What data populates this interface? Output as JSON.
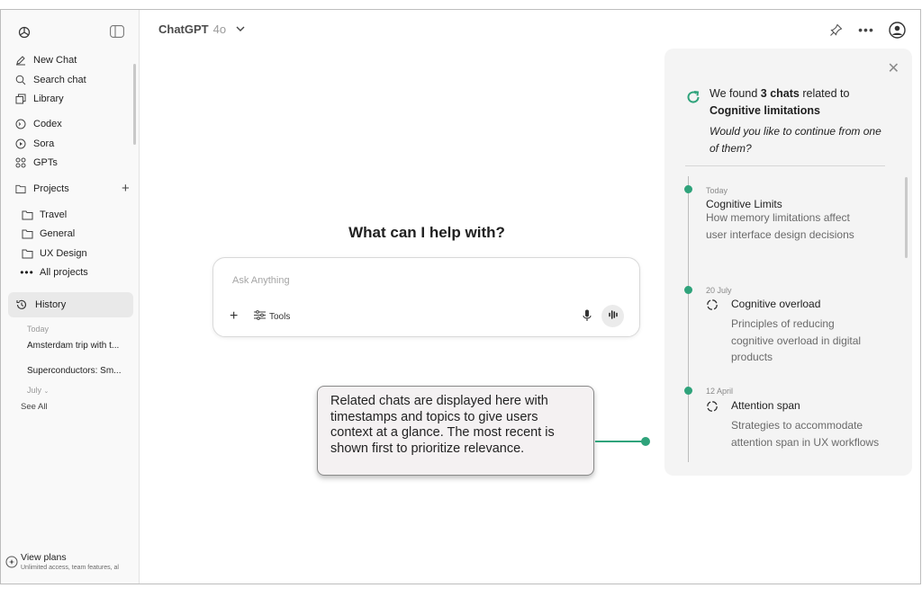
{
  "sidebar": {
    "new_chat": "New Chat",
    "search_chat": "Search chat",
    "library": "Library",
    "codex": "Codex",
    "sora": "Sora",
    "gpts": "GPTs",
    "projects_label": "Projects",
    "projects": [
      "Travel",
      "General",
      "UX Design",
      "All projects"
    ],
    "history_label": "History",
    "history_today": "Today",
    "history_items": [
      "Amsterdam trip with t...",
      "Superconductors: Sm..."
    ],
    "history_july": "July",
    "see_all": "See All",
    "view_plans": "View plans",
    "view_plans_sub": "Unlimited access, team features, al"
  },
  "header": {
    "model_name": "ChatGPT",
    "model_version": "4o"
  },
  "main": {
    "headline": "What can I help with?",
    "input_placeholder": "Ask Anything",
    "tools_label": "Tools"
  },
  "callout": {
    "text": "Related chats are displayed here with timestamps and topics to give users context at a glance. The most recent is shown first to prioritize relevance."
  },
  "panel": {
    "found_prefix": "We found ",
    "found_count": "3 chats",
    "found_suffix": " related to",
    "topic": "Cognitive limitations",
    "question": "Would you like to continue from one of them?",
    "chats": [
      {
        "date": "Today",
        "title": "Cognitive Limits",
        "desc": "How memory limitations affect user interface design decisions"
      },
      {
        "date": "20 July",
        "title": "Cognitive overload",
        "desc": "Principles of reducing cognitive overload in digital products"
      },
      {
        "date": "12 April",
        "title": "Attention span",
        "desc": "Strategies to accommodate attention span in UX workflows"
      }
    ]
  },
  "colors": {
    "accent": "#2fa37b",
    "sidebar_bg": "#f9f9f9",
    "panel_bg": "#f4f4f4"
  }
}
